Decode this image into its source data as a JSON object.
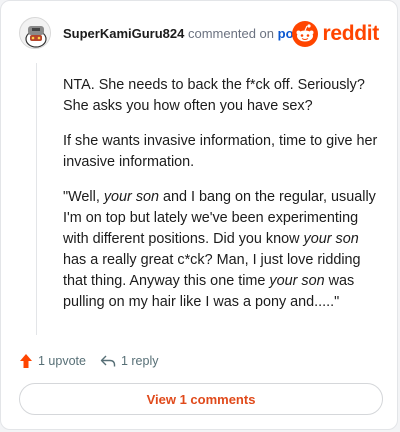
{
  "header": {
    "username": "SuperKamiGuru824",
    "action_text": "commented on",
    "post_link": "post",
    "brand": "reddit"
  },
  "comment": {
    "p1": "NTA. She needs to back the f*ck off. Seriously? She asks you how often you have sex?",
    "p2": "If she wants invasive information, time to give her invasive information.",
    "p3": [
      "\"Well, ",
      "your son",
      " and I bang on the regular, usually I'm on top but lately we've been experimenting with different positions. Did you know ",
      "your son",
      " has a really great c*ck? Man, I just love ridding that thing. Anyway this one time ",
      "your son",
      " was pulling on my hair like I was a pony and.....\""
    ]
  },
  "actions": {
    "upvote_label": "1 upvote",
    "reply_label": "1 reply"
  },
  "footer": {
    "view_comments_label": "View 1 comments"
  },
  "colors": {
    "brand": "#ff4500",
    "upvote": "#ff4500",
    "link": "#0b57d0"
  },
  "icons": {
    "avatar": "snoo-avatar",
    "brand": "reddit-logo-icon",
    "upvote": "upvote-arrow-icon",
    "reply": "reply-arrow-icon"
  }
}
